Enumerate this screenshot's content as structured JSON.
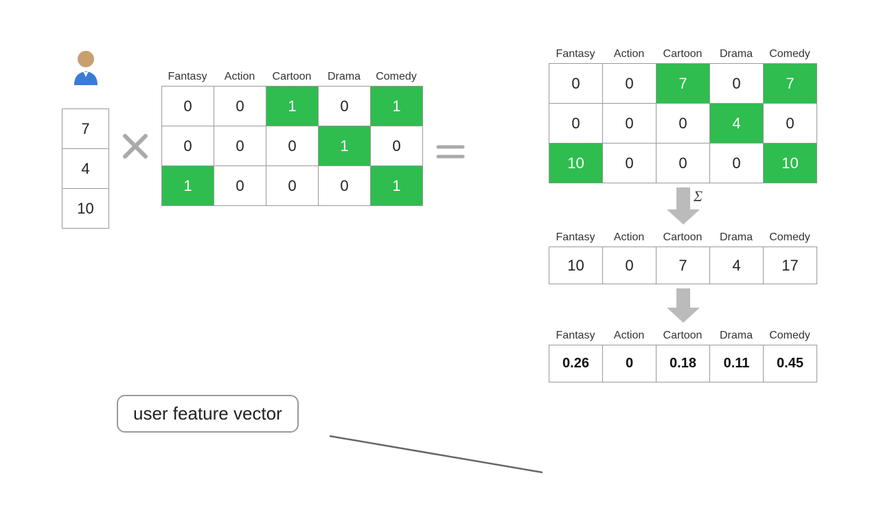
{
  "avatar": {
    "alt": "user avatar"
  },
  "rating_vector": {
    "values": [
      7,
      4,
      10
    ]
  },
  "multiply": "×",
  "equals": "=",
  "genre_matrix": {
    "headers": [
      "Fantasy",
      "Action",
      "Cartoon",
      "Drama",
      "Comedy"
    ],
    "rows": [
      [
        {
          "val": 0,
          "green": false
        },
        {
          "val": 0,
          "green": false
        },
        {
          "val": 1,
          "green": true
        },
        {
          "val": 0,
          "green": false
        },
        {
          "val": 1,
          "green": true
        }
      ],
      [
        {
          "val": 0,
          "green": false
        },
        {
          "val": 0,
          "green": false
        },
        {
          "val": 0,
          "green": false
        },
        {
          "val": 1,
          "green": true
        },
        {
          "val": 0,
          "green": false
        }
      ],
      [
        {
          "val": 1,
          "green": true
        },
        {
          "val": 0,
          "green": false
        },
        {
          "val": 0,
          "green": false
        },
        {
          "val": 0,
          "green": false
        },
        {
          "val": 1,
          "green": true
        }
      ]
    ]
  },
  "result_matrix": {
    "headers": [
      "Fantasy",
      "Action",
      "Cartoon",
      "Drama",
      "Comedy"
    ],
    "rows": [
      [
        {
          "val": 0,
          "green": false
        },
        {
          "val": 0,
          "green": false
        },
        {
          "val": 7,
          "green": true
        },
        {
          "val": 0,
          "green": false
        },
        {
          "val": 7,
          "green": true
        }
      ],
      [
        {
          "val": 0,
          "green": false
        },
        {
          "val": 0,
          "green": false
        },
        {
          "val": 0,
          "green": false
        },
        {
          "val": 4,
          "green": true
        },
        {
          "val": 0,
          "green": false
        }
      ],
      [
        {
          "val": 10,
          "green": true
        },
        {
          "val": 0,
          "green": false
        },
        {
          "val": 0,
          "green": false
        },
        {
          "val": 0,
          "green": false
        },
        {
          "val": 10,
          "green": true
        }
      ]
    ]
  },
  "sigma": "Σ",
  "sum_row": {
    "headers": [
      "Fantasy",
      "Action",
      "Cartoon",
      "Drama",
      "Comedy"
    ],
    "values": [
      10,
      0,
      7,
      4,
      17
    ]
  },
  "norm_row": {
    "headers": [
      "Fantasy",
      "Action",
      "Cartoon",
      "Drama",
      "Comedy"
    ],
    "values": [
      "0.26",
      "0",
      "0.18",
      "0.11",
      "0.45"
    ]
  },
  "user_feature_vector_label": "user feature vector"
}
